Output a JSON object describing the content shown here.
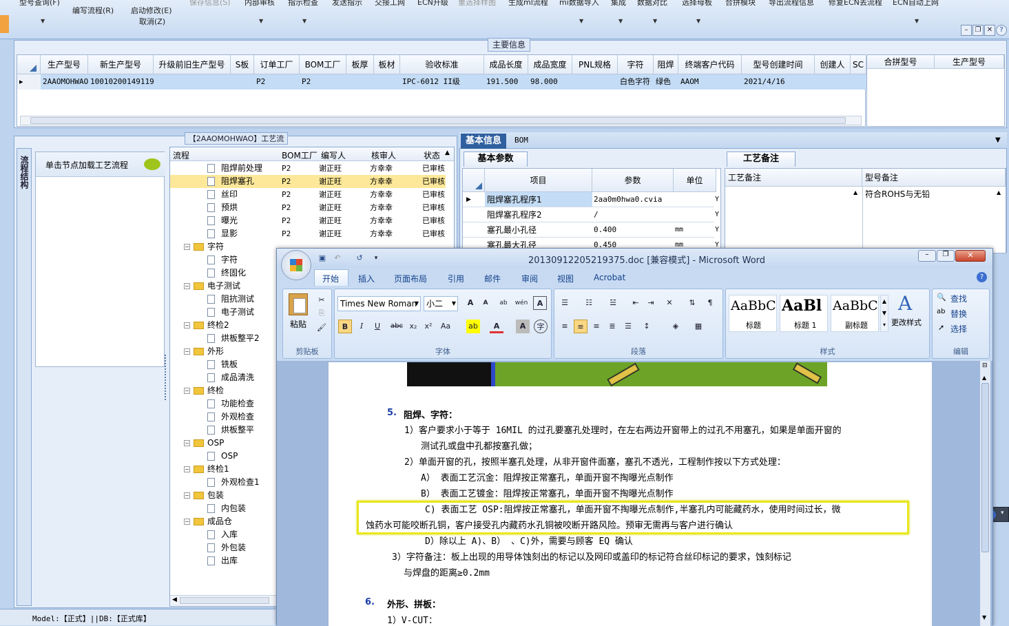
{
  "ribbon": {
    "row1": [
      "型号查询(F)",
      "保存信息(S)",
      "内部审核",
      "指示检查",
      "发送指示",
      "交接工网",
      "ECN升级",
      "重选择样图",
      "生成ml流程",
      "mi数据导入",
      "集成",
      "数据对比",
      "选择母板",
      "合拼模块",
      "导出流程信息",
      "修复ECN丢流程",
      "ECN自动上网"
    ],
    "write_flow": "编写流程(R)",
    "start_modify": "启动修改(E)",
    "cancel": "取消(Z)"
  },
  "main_info": {
    "title": "主要信息",
    "columns": [
      "生产型号",
      "新生产型号",
      "升级前旧生产型号",
      "S板",
      "订单工厂",
      "BOM工厂",
      "板厚",
      "板材",
      "验收标准",
      "成品长度",
      "成品宽度",
      "PNL规格",
      "字符",
      "阻焊",
      "终端客户代码",
      "型号创建时间",
      "创建人",
      "SC"
    ],
    "row": [
      "2AAOMOHWAO",
      "10010200149119",
      "",
      "",
      "P2",
      "P2",
      "",
      "",
      "IPC-6012 II级",
      "191.500",
      "98.000",
      "",
      "白色字符",
      "绿色",
      "AAOM",
      "2021/4/16",
      "",
      ""
    ],
    "merge_cols": [
      "合拼型号",
      "生产型号"
    ]
  },
  "flow": {
    "title": "【2AAOMOHWAO】工艺流程",
    "side_tab": "流程结构",
    "click_hint": "单击节点加载工艺流程",
    "columns": [
      "流程",
      "BOM工厂",
      "编写人",
      "核审人",
      "状态"
    ],
    "nodes": [
      {
        "name": "阻焊前处理",
        "bom": "P2",
        "writer": "谢正旺",
        "checker": "方幸幸",
        "status": "已审核",
        "type": "doc",
        "level": 2
      },
      {
        "name": "阻焊塞孔",
        "bom": "P2",
        "writer": "谢正旺",
        "checker": "方幸幸",
        "status": "已审核",
        "type": "doc",
        "level": 2,
        "selected": true
      },
      {
        "name": "丝印",
        "bom": "P2",
        "writer": "谢正旺",
        "checker": "方幸幸",
        "status": "已审核",
        "type": "doc",
        "level": 2
      },
      {
        "name": "预烘",
        "bom": "P2",
        "writer": "谢正旺",
        "checker": "方幸幸",
        "status": "已审核",
        "type": "doc",
        "level": 2
      },
      {
        "name": "曝光",
        "bom": "P2",
        "writer": "谢正旺",
        "checker": "方幸幸",
        "status": "已审核",
        "type": "doc",
        "level": 2
      },
      {
        "name": "显影",
        "bom": "P2",
        "writer": "谢正旺",
        "checker": "方幸幸",
        "status": "已审核",
        "type": "doc",
        "level": 2
      },
      {
        "name": "字符",
        "type": "folder",
        "level": 1
      },
      {
        "name": "字符",
        "type": "doc",
        "level": 2
      },
      {
        "name": "终固化",
        "type": "doc",
        "level": 2
      },
      {
        "name": "电子测试",
        "type": "folder",
        "level": 1
      },
      {
        "name": "阻抗测试",
        "type": "doc",
        "level": 2
      },
      {
        "name": "电子测试",
        "type": "doc",
        "level": 2
      },
      {
        "name": "终检2",
        "type": "folder",
        "level": 1
      },
      {
        "name": "烘板整平2",
        "type": "doc",
        "level": 2
      },
      {
        "name": "外形",
        "type": "folder",
        "level": 1
      },
      {
        "name": "铣板",
        "type": "doc",
        "level": 2
      },
      {
        "name": "成品清洗",
        "type": "doc",
        "level": 2
      },
      {
        "name": "终检",
        "type": "folder",
        "level": 1
      },
      {
        "name": "功能检查",
        "type": "doc",
        "level": 2
      },
      {
        "name": "外观检查",
        "type": "doc",
        "level": 2
      },
      {
        "name": "烘板整平",
        "type": "doc",
        "level": 2
      },
      {
        "name": "OSP",
        "type": "folder",
        "level": 1
      },
      {
        "name": "OSP",
        "type": "doc",
        "level": 2
      },
      {
        "name": "终检1",
        "type": "folder",
        "level": 1
      },
      {
        "name": "外观检查1",
        "type": "doc",
        "level": 2
      },
      {
        "name": "包装",
        "type": "folder",
        "level": 1
      },
      {
        "name": "内包装",
        "type": "doc",
        "level": 2
      },
      {
        "name": "成品仓",
        "type": "folder",
        "level": 1
      },
      {
        "name": "入库",
        "type": "doc",
        "level": 2
      },
      {
        "name": "外包装",
        "type": "doc",
        "level": 2
      },
      {
        "name": "出库",
        "type": "doc",
        "level": 2
      }
    ]
  },
  "basic": {
    "tab_basic_info": "基本信息",
    "tab_bom": "BOM",
    "tab_basic_params": "基本参数",
    "tab_remarks": "工艺备注",
    "columns": [
      "项目",
      "参数",
      "单位"
    ],
    "rows": [
      {
        "item": "阻焊塞孔程序1",
        "param": "2aa0m0hwa0.cvia",
        "unit": "",
        "flag": "Y"
      },
      {
        "item": "阻焊塞孔程序2",
        "param": "/",
        "unit": "",
        "flag": "Y"
      },
      {
        "item": "塞孔最小孔径",
        "param": "0.400",
        "unit": "mm",
        "flag": "Y"
      },
      {
        "item": "塞孔最大孔径",
        "param": "0.450",
        "unit": "mm",
        "flag": "Y"
      }
    ],
    "remark_col": "工艺备注",
    "model_remark_col": "型号备注",
    "model_remark": "符合ROHS与无铅"
  },
  "status_bar": "Model:【正式】||DB:【正式库】",
  "lang_bar": "CH",
  "word": {
    "title": "20130912205219375.doc [兼容模式] - Microsoft Word",
    "tabs": [
      "开始",
      "插入",
      "页面布局",
      "引用",
      "邮件",
      "审阅",
      "视图",
      "Acrobat"
    ],
    "font_name": "Times New Roman",
    "font_size": "小二",
    "groups": [
      "剪贴板",
      "字体",
      "段落",
      "样式",
      "编辑"
    ],
    "paste": "粘贴",
    "styles": [
      {
        "preview": "AaBbC",
        "name": "标题"
      },
      {
        "preview": "AaBl",
        "name": "标题 1"
      },
      {
        "preview": "AaBbC",
        "name": "副标题"
      }
    ],
    "change_styles": "更改样式",
    "edit": [
      "查找",
      "替换",
      "选择"
    ],
    "doc": {
      "h5_num": "5.",
      "h5": "阻焊、字符：",
      "p1a": "1）客户要求小于等于 16MIL 的过孔要塞孔处理时，在左右两边开窗带上的过孔不用塞孔，如果是单面开窗的",
      "p1b": "测试孔或盘中孔都按塞孔做；",
      "p2": "2）单面开窗的孔，按照半塞孔处理，从非开窗件面塞，塞孔不透光，工程制作按以下方式处理：",
      "pA": "A） 表面工艺沉金：阻焊按正常塞孔，单面开窗不掏曝光点制作",
      "pB": "B） 表面工艺镀金：阻焊按正常塞孔，单面开窗不掏曝光点制作",
      "pC1": "C)  表面工艺 OSP:阻焊按正常塞孔，单面开窗不掏曝光点制作,半塞孔内可能藏药水，使用时间过长，微",
      "pC2": "蚀药水可能咬断孔铜，客户接受孔内藏药水孔铜被咬断开路风险。预审无需再与客户进行确认",
      "pD": "D）除以上 A)、B） 、C)外，需要与顾客 EQ 确认",
      "p3a": "3）字符备注：板上出现的用导体蚀刻出的标记以及网印或盖印的标记符合丝印标记的要求，蚀刻标记",
      "p3b": "与焊盘的距离≥0.2mm",
      "h6_num": "6.",
      "h6": "外形、拼板：",
      "p6_1": "1）V-CUT："
    }
  }
}
